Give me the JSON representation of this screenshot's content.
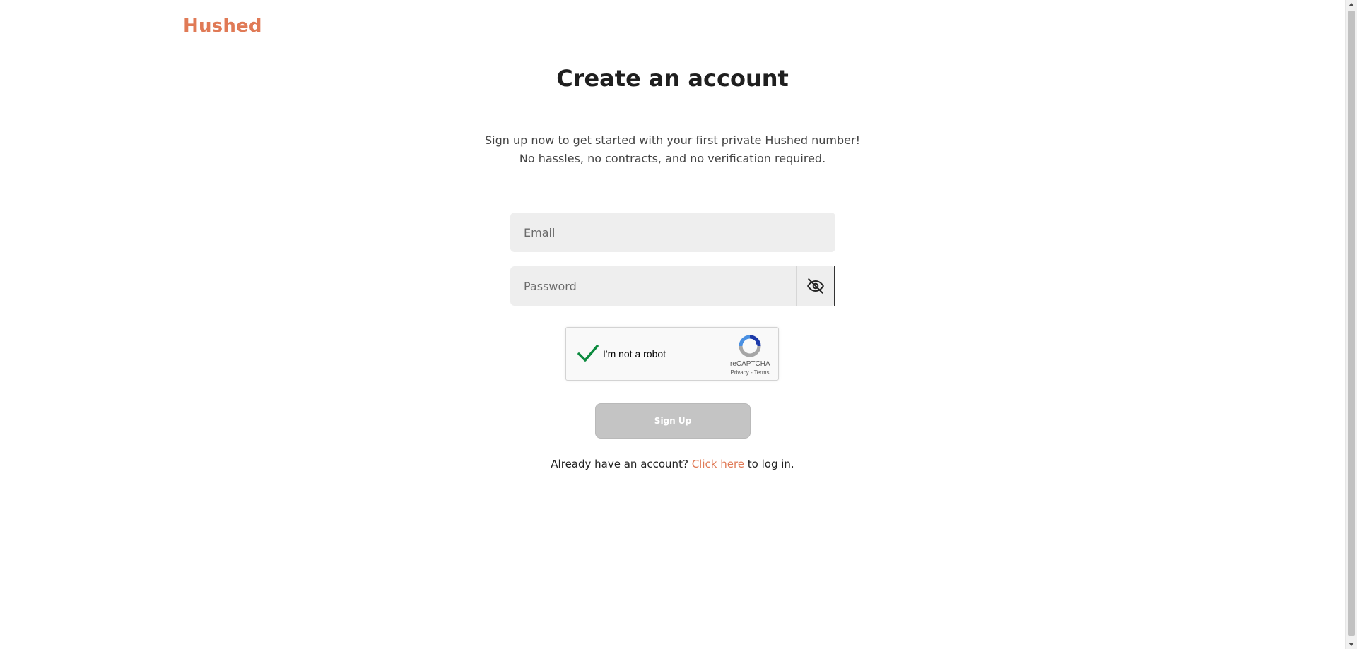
{
  "brand": {
    "name": "Hushed",
    "color": "#e07a56"
  },
  "page": {
    "title": "Create an account",
    "subtitle_line1": "Sign up now to get started with your first private Hushed number!",
    "subtitle_line2": "No hassles, no contracts, and no verification required."
  },
  "form": {
    "email": {
      "placeholder": "Email",
      "value": ""
    },
    "password": {
      "placeholder": "Password",
      "value": "",
      "toggle_icon": "eye-slash-icon"
    },
    "recaptcha": {
      "label": "I'm not a robot",
      "checked": true,
      "brand": "reCAPTCHA",
      "privacy": "Privacy",
      "separator": " - ",
      "terms": "Terms"
    },
    "submit_label": "Sign Up"
  },
  "login_prompt": {
    "before": "Already have an account?",
    "link": "Click here",
    "after": "to log in."
  }
}
